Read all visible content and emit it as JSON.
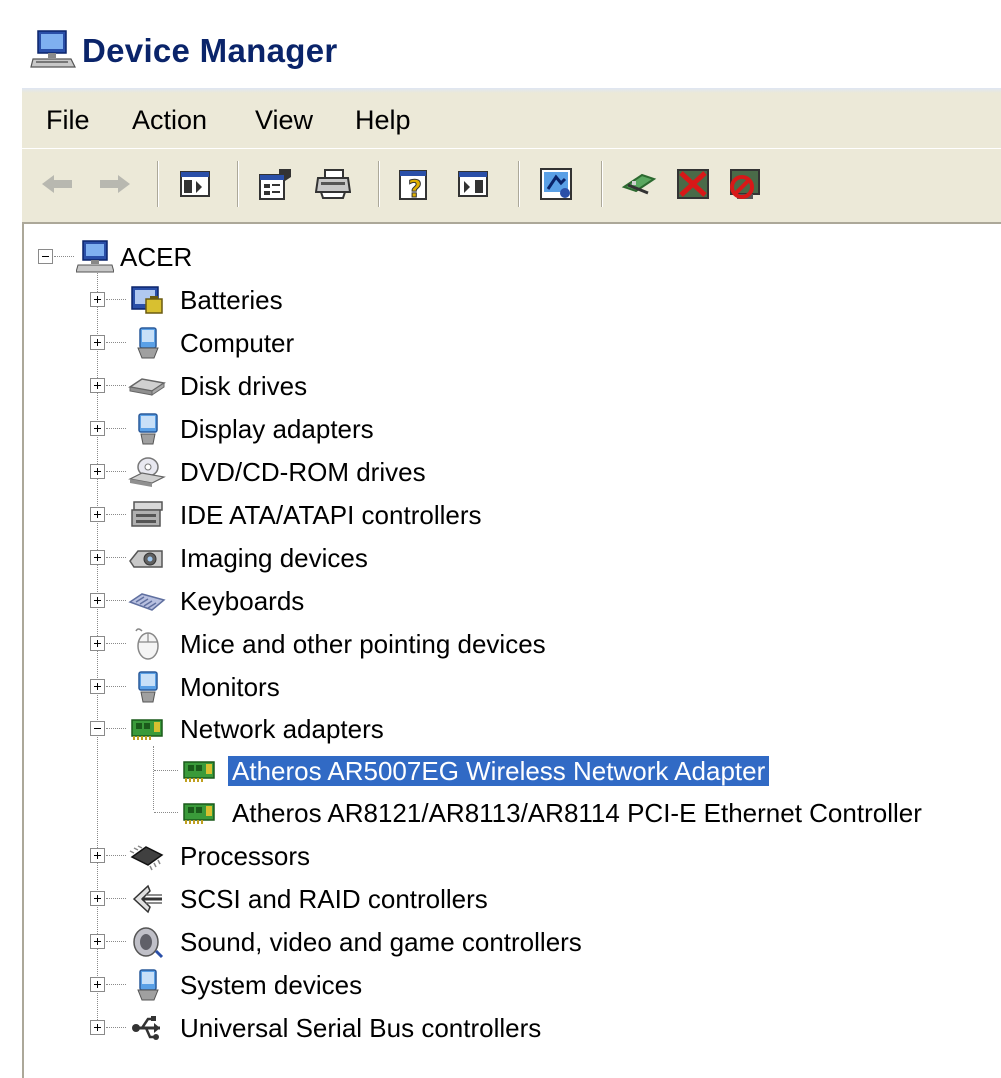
{
  "window": {
    "title": "Device Manager"
  },
  "menu": {
    "items": [
      "File",
      "Action",
      "View",
      "Help"
    ]
  },
  "toolbar": {
    "buttons": [
      {
        "icon": "back-arrow-icon"
      },
      {
        "icon": "forward-arrow-icon"
      },
      {
        "icon": "show-hide-console-tree-icon"
      },
      {
        "icon": "properties-icon"
      },
      {
        "icon": "print-icon"
      },
      {
        "icon": "help-icon"
      },
      {
        "icon": "show-hide-action-pane-icon"
      },
      {
        "icon": "scan-hardware-changes-icon"
      },
      {
        "icon": "update-driver-icon"
      },
      {
        "icon": "uninstall-icon"
      },
      {
        "icon": "disable-icon"
      }
    ]
  },
  "tree": {
    "root": {
      "label": "ACER",
      "icon": "computer-icon",
      "expanded": true
    },
    "categories": [
      {
        "label": "Batteries",
        "icon": "battery-icon",
        "expanded": false
      },
      {
        "label": "Computer",
        "icon": "computer-icon",
        "expanded": false
      },
      {
        "label": "Disk drives",
        "icon": "disk-drive-icon",
        "expanded": false
      },
      {
        "label": "Display adapters",
        "icon": "monitor-icon",
        "expanded": false
      },
      {
        "label": "DVD/CD-ROM drives",
        "icon": "cd-drive-icon",
        "expanded": false
      },
      {
        "label": "IDE ATA/ATAPI controllers",
        "icon": "ide-controller-icon",
        "expanded": false
      },
      {
        "label": "Imaging devices",
        "icon": "camera-icon",
        "expanded": false
      },
      {
        "label": "Keyboards",
        "icon": "keyboard-icon",
        "expanded": false
      },
      {
        "label": "Mice and other pointing devices",
        "icon": "mouse-icon",
        "expanded": false
      },
      {
        "label": "Monitors",
        "icon": "monitor-icon",
        "expanded": false
      },
      {
        "label": "Network adapters",
        "icon": "network-card-icon",
        "expanded": true,
        "children": [
          {
            "label": "Atheros AR5007EG Wireless Network Adapter",
            "icon": "network-card-icon",
            "selected": true
          },
          {
            "label": "Atheros AR8121/AR8113/AR8114 PCI-E Ethernet Controller",
            "icon": "network-card-icon",
            "selected": false
          }
        ]
      },
      {
        "label": "Processors",
        "icon": "processor-icon",
        "expanded": false
      },
      {
        "label": "SCSI and RAID controllers",
        "icon": "scsi-controller-icon",
        "expanded": false
      },
      {
        "label": "Sound, video and game controllers",
        "icon": "speaker-icon",
        "expanded": false
      },
      {
        "label": "System devices",
        "icon": "computer-icon",
        "expanded": false
      },
      {
        "label": "Universal Serial Bus controllers",
        "icon": "usb-icon",
        "expanded": false
      }
    ]
  },
  "colors": {
    "title_text": "#0a246a",
    "selection": "#316ac5",
    "bar_background": "#ece9d8"
  }
}
